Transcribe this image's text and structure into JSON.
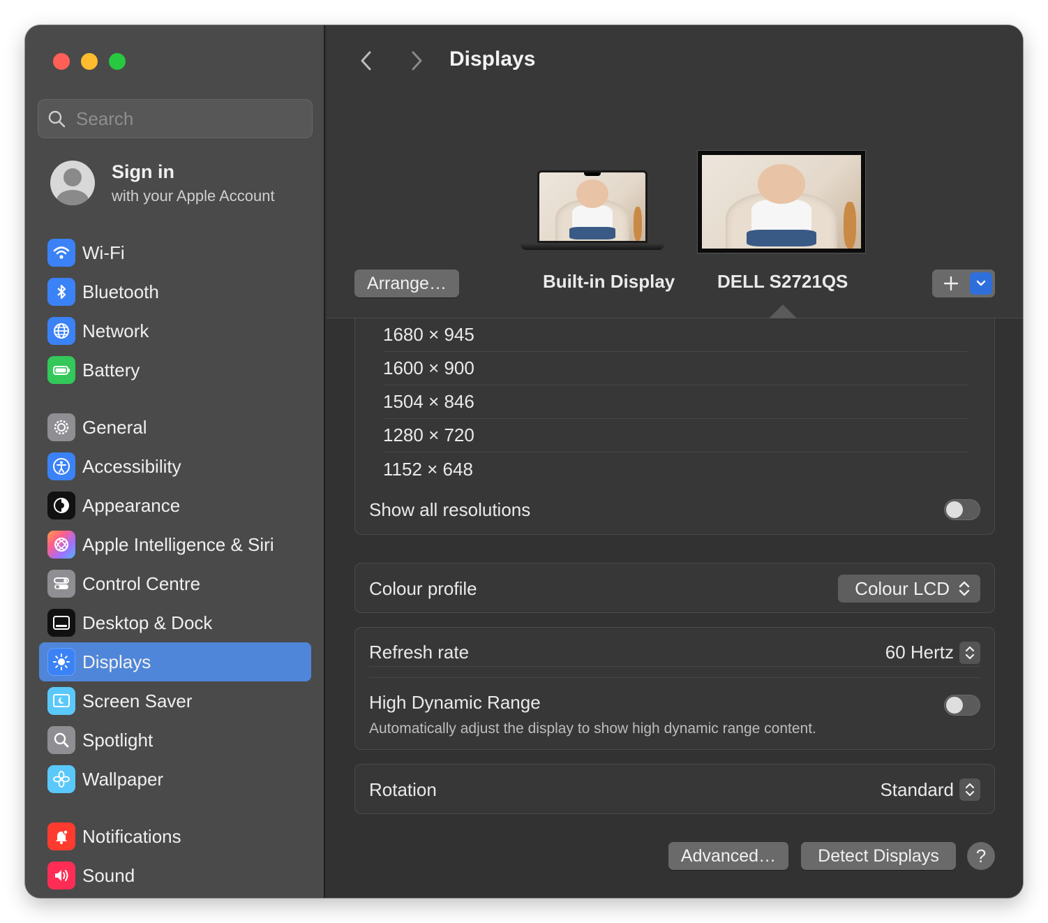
{
  "sidebar": {
    "search_placeholder": "Search",
    "account": {
      "title": "Sign in",
      "subtitle": "with your Apple Account"
    },
    "items": [
      {
        "label": "Wi-Fi",
        "icon": "wifi-icon",
        "color": "#3b82f6"
      },
      {
        "label": "Bluetooth",
        "icon": "bluetooth-icon",
        "color": "#3b82f6"
      },
      {
        "label": "Network",
        "icon": "globe-icon",
        "color": "#3b82f6"
      },
      {
        "label": "Battery",
        "icon": "battery-icon",
        "color": "#34c759"
      },
      {
        "label": "General",
        "icon": "gear-icon",
        "color": "#8e8e93"
      },
      {
        "label": "Accessibility",
        "icon": "accessibility-icon",
        "color": "#3b82f6"
      },
      {
        "label": "Appearance",
        "icon": "appearance-icon",
        "color": "#111111"
      },
      {
        "label": "Apple Intelligence & Siri",
        "icon": "siri-icon",
        "color": "#e0b0ff"
      },
      {
        "label": "Control Centre",
        "icon": "control-centre-icon",
        "color": "#8e8e93"
      },
      {
        "label": "Desktop & Dock",
        "icon": "dock-icon",
        "color": "#111111"
      },
      {
        "label": "Displays",
        "icon": "sun-icon",
        "color": "#3b82f6",
        "selected": true
      },
      {
        "label": "Screen Saver",
        "icon": "screen-saver-icon",
        "color": "#5ac8fa"
      },
      {
        "label": "Spotlight",
        "icon": "magnifier-icon",
        "color": "#8e8e93"
      },
      {
        "label": "Wallpaper",
        "icon": "flower-icon",
        "color": "#5ac8fa"
      },
      {
        "label": "Notifications",
        "icon": "bell-icon",
        "color": "#ff3b30"
      },
      {
        "label": "Sound",
        "icon": "speaker-icon",
        "color": "#ff2d55"
      }
    ]
  },
  "header": {
    "title": "Displays"
  },
  "arrangement": {
    "arrange_button": "Arrange…",
    "displays": [
      "Built-in Display",
      "DELL S2721QS"
    ],
    "selected_display": "DELL S2721QS"
  },
  "resolutions": [
    "1680 × 945",
    "1600 × 900",
    "1504 × 846",
    "1280 × 720",
    "1152 × 648"
  ],
  "show_all_resolutions": {
    "label": "Show all resolutions",
    "on": false
  },
  "colour_profile": {
    "label": "Colour profile",
    "value": "Colour LCD"
  },
  "refresh_rate": {
    "label": "Refresh rate",
    "value": "60 Hertz"
  },
  "hdr": {
    "label": "High Dynamic Range",
    "description": "Automatically adjust the display to show high dynamic range content.",
    "on": false
  },
  "rotation": {
    "label": "Rotation",
    "value": "Standard"
  },
  "footer": {
    "advanced": "Advanced…",
    "detect": "Detect Displays",
    "help": "?"
  }
}
